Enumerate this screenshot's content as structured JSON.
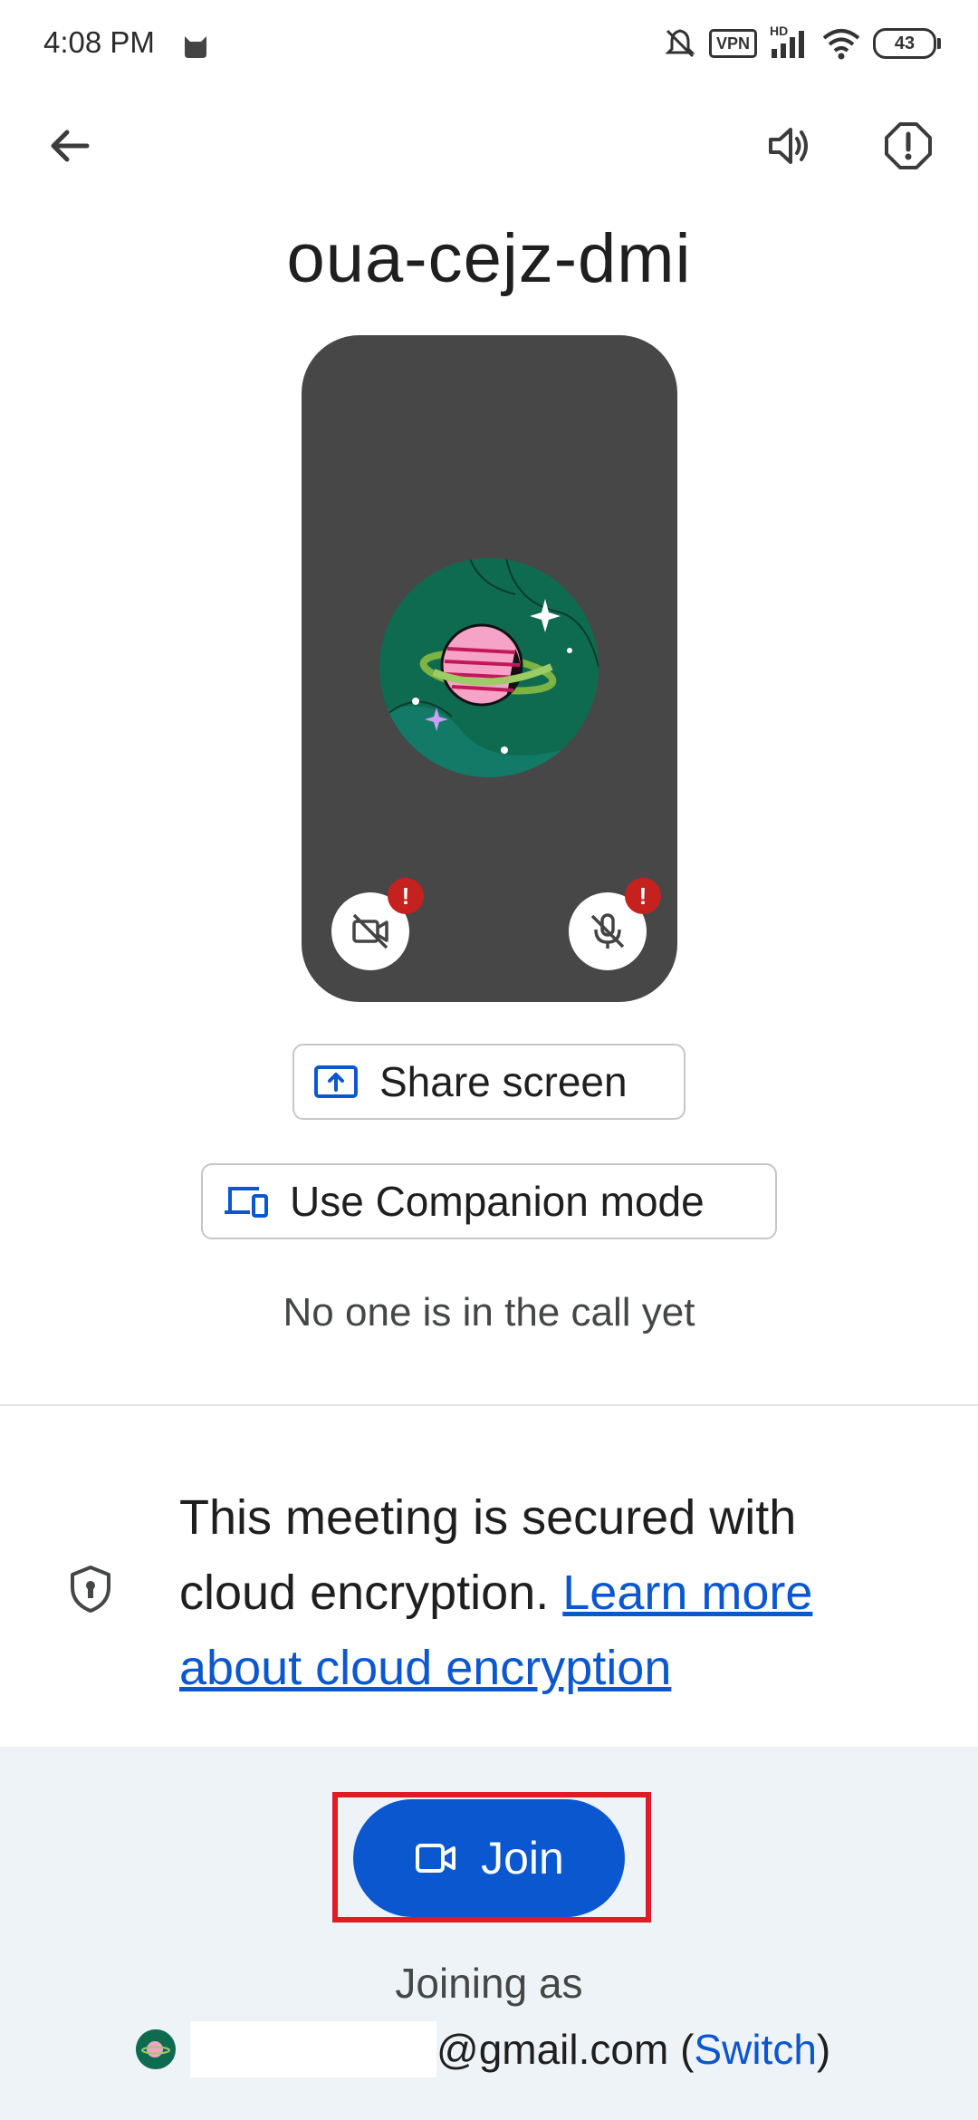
{
  "status_bar": {
    "time": "4:08 PM",
    "vpn": "VPN",
    "network": "HD",
    "battery": "43"
  },
  "meeting": {
    "code": "oua-cejz-dmi"
  },
  "buttons": {
    "share_screen": "Share screen",
    "companion_mode": "Use Companion mode",
    "join": "Join"
  },
  "call_status": "No one is in the call yet",
  "encryption": {
    "text": "This meeting is secured with cloud encryption.",
    "link": "Learn more about cloud encryption"
  },
  "account": {
    "joining_as": "Joining as",
    "email_suffix": "@gmail.com",
    "open_paren": "(",
    "switch_label": "Switch",
    "close_paren": ")"
  },
  "colors": {
    "accent": "#0b57d0",
    "preview_bg": "#474747",
    "warning": "#c5221f",
    "panel_bg": "#eef3f8"
  }
}
